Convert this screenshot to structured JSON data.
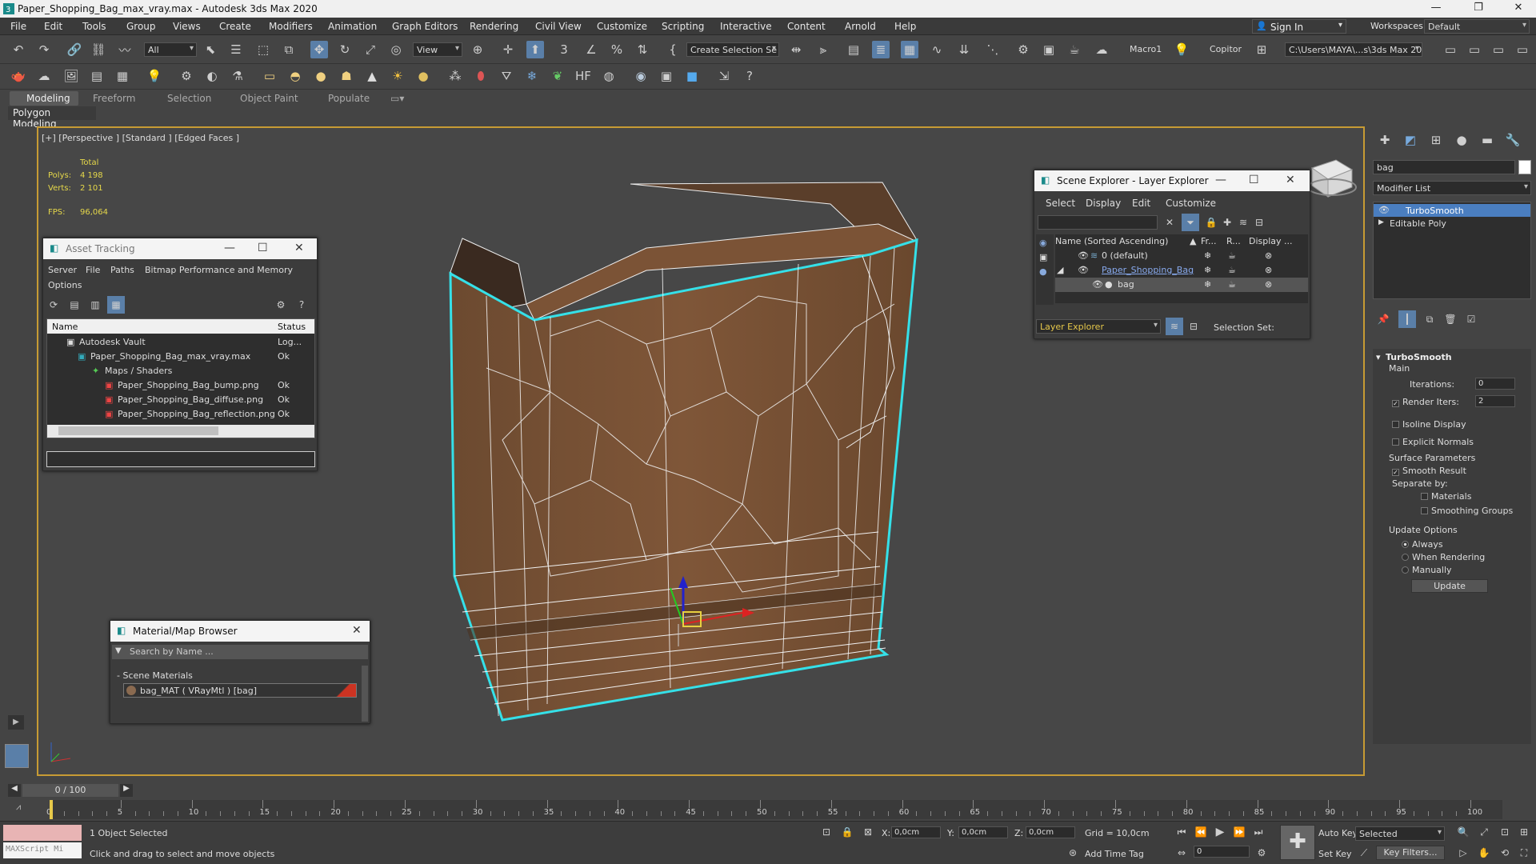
{
  "titlebar": {
    "title": "Paper_Shopping_Bag_max_vray.max - Autodesk 3ds Max 2020"
  },
  "menu": [
    "File",
    "Edit",
    "Tools",
    "Group",
    "Views",
    "Create",
    "Modifiers",
    "Animation",
    "Graph Editors",
    "Rendering",
    "Civil View",
    "Customize",
    "Scripting",
    "Interactive",
    "Content",
    "Arnold",
    "Help"
  ],
  "account": {
    "sign_in": "Sign In",
    "workspaces_label": "Workspaces:",
    "workspace": "Default"
  },
  "toolbar": {
    "selection_filter": "All",
    "ref_coord": "View",
    "named_selection": "Create Selection Se",
    "macro": "Macro1",
    "copitor": "Copitor",
    "project_path": "C:\\Users\\MAYA\\...s\\3ds Max 2020"
  },
  "ribbon": {
    "tabs": [
      "Modeling",
      "Freeform",
      "Selection",
      "Object Paint",
      "Populate"
    ],
    "subtab": "Polygon Modeling"
  },
  "viewport": {
    "label": "[+] [Perspective ] [Standard ] [Edged Faces ]",
    "stats": {
      "total_label": "Total",
      "polys_label": "Polys:",
      "polys": "4 198",
      "verts_label": "Verts:",
      "verts": "2 101",
      "fps_label": "FPS:",
      "fps": "96,064"
    }
  },
  "asset_tracking": {
    "title": "Asset Tracking",
    "menu": [
      "Server",
      "File",
      "Paths",
      "Bitmap Performance and Memory",
      "Options"
    ],
    "col_name": "Name",
    "col_status": "Status",
    "rows": [
      {
        "name": "Autodesk Vault",
        "status": "Log..."
      },
      {
        "name": "Paper_Shopping_Bag_max_vray.max",
        "status": "Ok"
      },
      {
        "name": "Maps / Shaders",
        "status": ""
      },
      {
        "name": "Paper_Shopping_Bag_bump.png",
        "status": "Ok"
      },
      {
        "name": "Paper_Shopping_Bag_diffuse.png",
        "status": "Ok"
      },
      {
        "name": "Paper_Shopping_Bag_reflection.png",
        "status": "Ok"
      }
    ]
  },
  "material_browser": {
    "title": "Material/Map Browser",
    "search_placeholder": "Search by Name ...",
    "section": "- Scene Materials",
    "item": "bag_MAT ( VRayMtl ) [bag]"
  },
  "scene_explorer": {
    "title": "Scene Explorer - Layer Explorer",
    "menu": [
      "Select",
      "Display",
      "Edit",
      "Customize"
    ],
    "col_name": "Name (Sorted Ascending)",
    "col_fr": "Fr...",
    "col_r": "R...",
    "col_display": "Display ...",
    "rows": [
      "0 (default)",
      "Paper_Shopping_Bag",
      "bag"
    ],
    "footer_mode": "Layer Explorer",
    "selection_set_label": "Selection Set:"
  },
  "command_panel": {
    "search": "bag",
    "modifier_list": "Modifier List",
    "stack": [
      "TurboSmooth",
      "Editable Poly"
    ],
    "rollout": "TurboSmooth",
    "main_label": "Main",
    "iterations_label": "Iterations:",
    "iterations": "0",
    "render_iters_label": "Render Iters:",
    "render_iters": "2",
    "isoline": "Isoline Display",
    "explicit_normals": "Explicit Normals",
    "surface_params": "Surface Parameters",
    "smooth_result": "Smooth Result",
    "separate_by": "Separate by:",
    "materials": "Materials",
    "smoothing_groups": "Smoothing Groups",
    "update_options": "Update Options",
    "always": "Always",
    "when_rendering": "When Rendering",
    "manually": "Manually",
    "update_button": "Update"
  },
  "timeline": {
    "frame": "0 / 100",
    "ticks": [
      "0",
      "5",
      "10",
      "15",
      "20",
      "25",
      "30",
      "35",
      "40",
      "45",
      "50",
      "55",
      "60",
      "65",
      "70",
      "75",
      "80",
      "85",
      "90",
      "95",
      "100"
    ]
  },
  "status": {
    "maxscript": "MAXScript Mi",
    "selected": "1 Object Selected",
    "prompt": "Click and drag to select and move objects",
    "x_label": "X:",
    "x": "0,0cm",
    "y_label": "Y:",
    "y": "0,0cm",
    "z_label": "Z:",
    "z": "0,0cm",
    "grid": "Grid = 10,0cm",
    "add_time_tag": "Add Time Tag",
    "auto_key": "Auto Key",
    "set_key": "Set Key",
    "key_mode": "Selected",
    "key_filters": "Key Filters...",
    "current_frame": "0"
  },
  "colors": {
    "accent": "#4a90d9",
    "viewport_border": "#c79b34",
    "selection_cyan": "#35e0e8",
    "bag_brown": "#7a5234"
  }
}
